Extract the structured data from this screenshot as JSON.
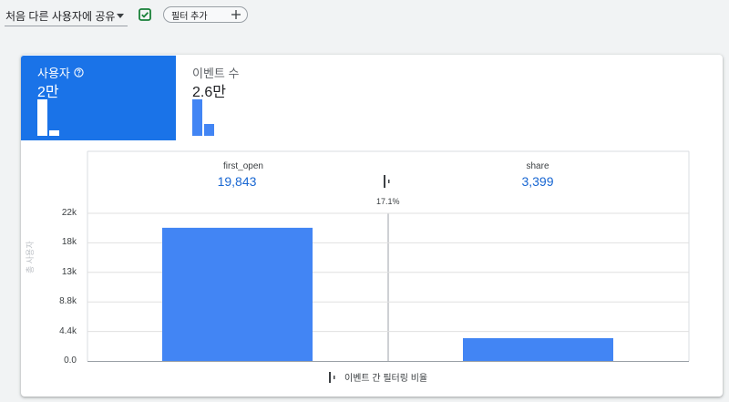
{
  "toolbar": {
    "segment_select": "처음 다른 사용자에 공유",
    "filter_chip": "필터 추가"
  },
  "metrics": {
    "active": {
      "name": "사용자",
      "value": "2만",
      "spark": [
        1.0,
        0.15
      ]
    },
    "other": {
      "name": "이벤트 수",
      "value": "2.6만",
      "spark": [
        1.0,
        0.3
      ]
    }
  },
  "funnel": {
    "steps": [
      {
        "label": "first_open",
        "value": "19,843"
      },
      {
        "label": "share",
        "value": "3,399"
      }
    ],
    "rate": "17.1%",
    "legend": "이벤트 간 필터링 비율"
  },
  "chart_data": {
    "type": "bar",
    "categories": [
      "first_open",
      "share"
    ],
    "values": [
      19843,
      3399
    ],
    "ylabel": "총 사용자",
    "yticks": [
      "0.0",
      "4.4k",
      "8.8k",
      "13k",
      "18k",
      "22k"
    ],
    "ylim": [
      0,
      22000
    ],
    "color": "#4285f4",
    "grid": true
  },
  "colors": {
    "accent": "#1a73e8",
    "bar": "#4285f4",
    "check": "#188038"
  }
}
